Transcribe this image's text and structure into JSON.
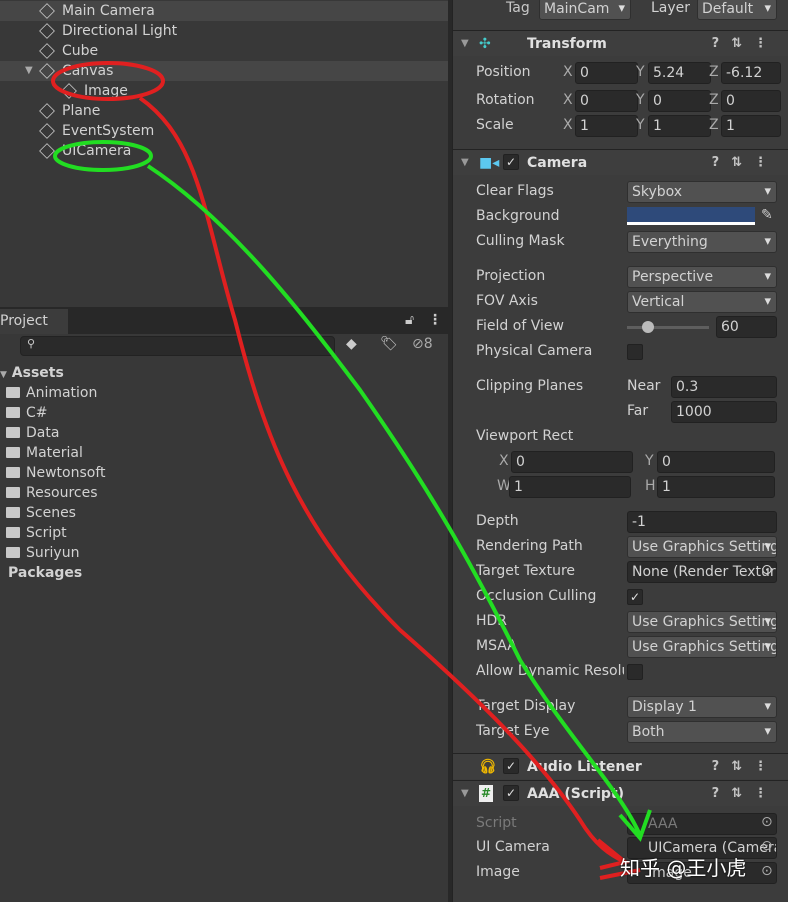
{
  "hierarchy": {
    "items": [
      {
        "label": "Main Camera"
      },
      {
        "label": "Directional Light"
      },
      {
        "label": "Cube"
      },
      {
        "label": "Canvas"
      },
      {
        "label": "Image"
      },
      {
        "label": "Plane"
      },
      {
        "label": "EventSystem"
      },
      {
        "label": "UICamera"
      }
    ]
  },
  "project": {
    "tab": "Project",
    "hidden_count": "8",
    "search_value": "",
    "assets_label": "Assets",
    "folders": [
      "Animation",
      "C#",
      "Data",
      "Material",
      "Newtonsoft",
      "Resources",
      "Scenes",
      "Script",
      "Suriyun"
    ],
    "packages_label": "Packages"
  },
  "inspector": {
    "tag_label": "Tag",
    "tag_value": "MainCam",
    "layer_label": "Layer",
    "layer_value": "Default",
    "transform": {
      "title": "Transform",
      "rows": [
        {
          "label": "Position",
          "x": "0",
          "y": "5.24",
          "z": "-6.12"
        },
        {
          "label": "Rotation",
          "x": "0",
          "y": "0",
          "z": "0"
        },
        {
          "label": "Scale",
          "x": "1",
          "y": "1",
          "z": "1"
        }
      ]
    },
    "camera": {
      "title": "Camera",
      "enabled": true,
      "fields": [
        {
          "label": "Clear Flags",
          "value": "Skybox"
        },
        {
          "label": "Background",
          "value": ""
        },
        {
          "label": "Culling Mask",
          "value": "Everything"
        },
        {
          "label": "Projection",
          "value": "Perspective"
        },
        {
          "label": "FOV Axis",
          "value": "Vertical"
        },
        {
          "label": "Field of View",
          "value": "60"
        },
        {
          "label": "Physical Camera",
          "value": ""
        },
        {
          "label": "Clipping Planes",
          "value": ""
        },
        {
          "label": "Viewport Rect",
          "value": ""
        },
        {
          "label": "Depth",
          "value": "-1"
        },
        {
          "label": "Rendering Path",
          "value": "Use Graphics Settings"
        },
        {
          "label": "Target Texture",
          "value": "None (Render Texture)"
        },
        {
          "label": "Occlusion Culling",
          "value": ""
        },
        {
          "label": "HDR",
          "value": "Use Graphics Settings"
        },
        {
          "label": "MSAA",
          "value": "Use Graphics Settings"
        },
        {
          "label": "Allow Dynamic Resolution",
          "value": ""
        },
        {
          "label": "Target Display",
          "value": "Display 1"
        },
        {
          "label": "Target Eye",
          "value": "Both"
        }
      ],
      "fov_fraction": 0.25,
      "near_label": "Near",
      "near": "0.3",
      "far_label": "Far",
      "far": "1000",
      "viewport": {
        "x": "0",
        "y": "0",
        "w": "1",
        "h": "1"
      },
      "background_color": "#2e4a7a"
    },
    "audio_listener": {
      "title": "Audio Listener"
    },
    "script": {
      "title": "AAA (Script)",
      "fields": [
        {
          "label": "Script",
          "value": "AAA"
        },
        {
          "label": "UI Camera",
          "value": "UICamera (Camera)"
        },
        {
          "label": "Image",
          "value": "Image"
        }
      ]
    }
  },
  "watermark": "知乎 @王小虎",
  "annotation_colors": {
    "red": "#e02020",
    "green": "#22dd22"
  }
}
